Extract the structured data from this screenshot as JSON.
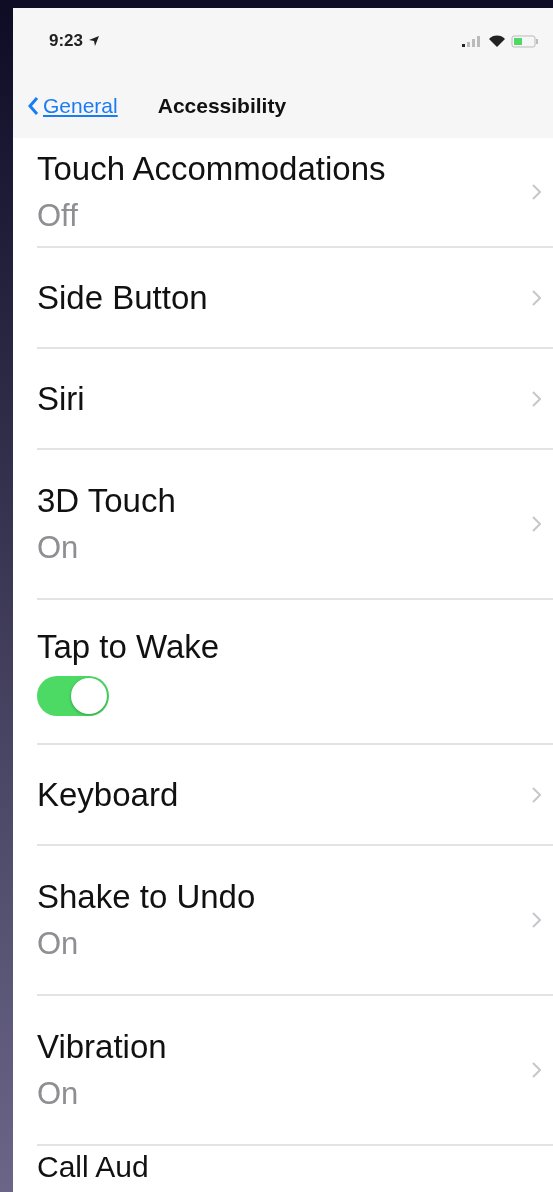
{
  "status_bar": {
    "time": "9:23"
  },
  "nav": {
    "back": "General",
    "title": "Accessibility"
  },
  "rows": [
    {
      "kind": "link",
      "label": "Touch Accommodations",
      "value": "Off"
    },
    {
      "kind": "link",
      "label": "Side Button"
    },
    {
      "kind": "link",
      "label": "Siri"
    },
    {
      "kind": "link",
      "label": "3D Touch",
      "value": "On"
    },
    {
      "kind": "toggle",
      "label": "Tap to Wake",
      "on": true
    },
    {
      "kind": "link",
      "label": "Keyboard"
    },
    {
      "kind": "link",
      "label": "Shake to Undo",
      "value": "On"
    },
    {
      "kind": "link",
      "label": "Vibration",
      "value": "On"
    },
    {
      "kind": "partial",
      "label": "Call Aud"
    }
  ]
}
